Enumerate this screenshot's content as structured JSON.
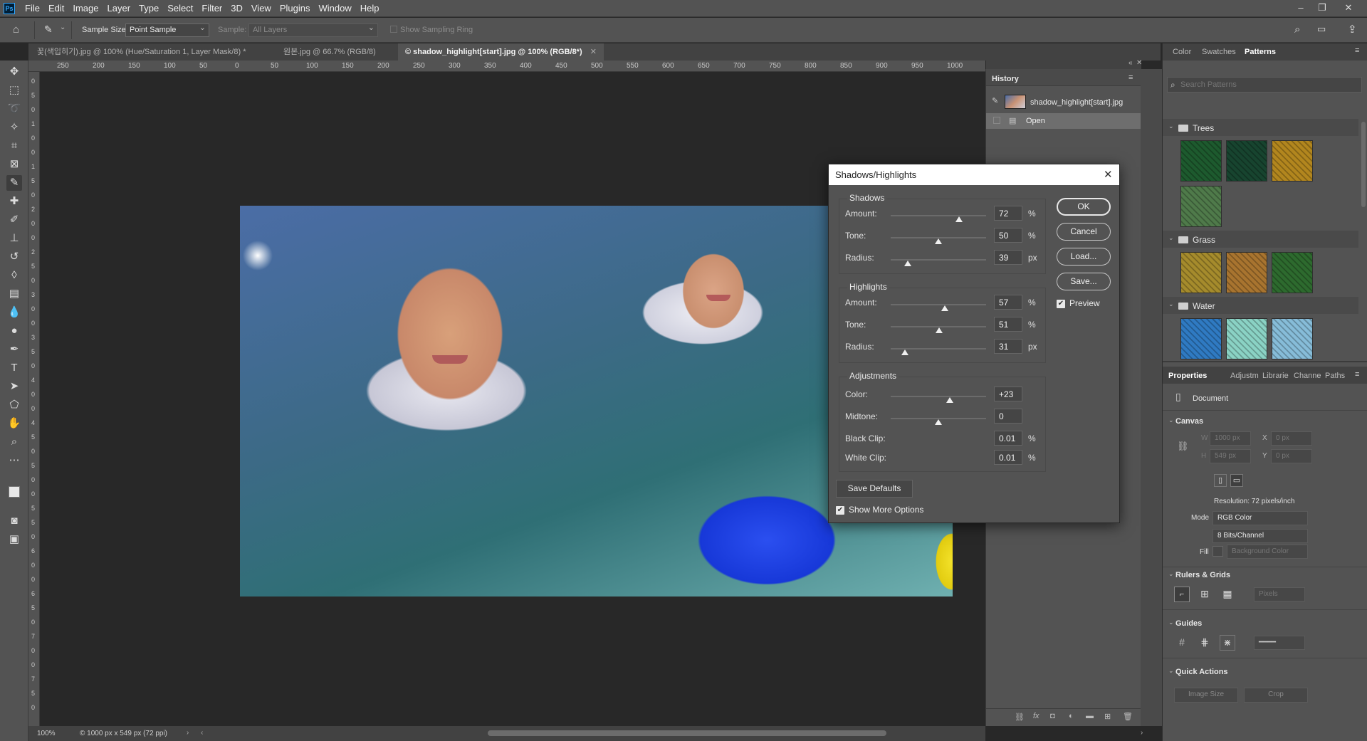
{
  "app": {
    "logo": "Ps",
    "menu": [
      "File",
      "Edit",
      "Image",
      "Layer",
      "Type",
      "Select",
      "Filter",
      "3D",
      "View",
      "Plugins",
      "Window",
      "Help"
    ],
    "window_controls": [
      "minimize-icon",
      "restore-icon",
      "close-icon"
    ]
  },
  "options": {
    "sample_size_label": "Sample Size:",
    "sample_size_value": "Point Sample",
    "sample_label": "Sample:",
    "sample_value": "All Layers",
    "sampling_ring_label": "Show Sampling Ring"
  },
  "tabs": [
    {
      "label": "꽃(색입히기).jpg @ 100% (Hue/Saturation 1, Layer Mask/8) *",
      "active": false
    },
    {
      "label": "원본.jpg @ 66.7% (RGB/8)",
      "active": false
    },
    {
      "label": "© shadow_highlight[start].jpg @ 100% (RGB/8*)",
      "active": true
    }
  ],
  "ruler_h": [
    "250",
    "200",
    "150",
    "100",
    "50",
    "0",
    "50",
    "100",
    "150",
    "200",
    "250",
    "300",
    "350",
    "400",
    "450",
    "500",
    "550",
    "600",
    "650",
    "700",
    "750",
    "800",
    "850",
    "900",
    "950",
    "1000"
  ],
  "ruler_v": [
    "0",
    "5",
    "0",
    "1",
    "0",
    "0",
    "1",
    "5",
    "0",
    "2",
    "0",
    "0",
    "2",
    "5",
    "0",
    "3",
    "0",
    "0",
    "3",
    "5",
    "0",
    "4",
    "0",
    "0",
    "4",
    "5",
    "0",
    "5",
    "0",
    "0",
    "5",
    "5",
    "0",
    "6",
    "0",
    "0",
    "6",
    "5",
    "0",
    "7",
    "0",
    "0",
    "7",
    "5",
    "0"
  ],
  "status": {
    "zoom": "100%",
    "doc_info": "© 1000 px x 549 px (72 ppi)"
  },
  "history": {
    "title": "History",
    "snapshot_label": "shadow_highlight[start].jpg",
    "items": [
      {
        "label": "Open"
      }
    ]
  },
  "patterns_panel": {
    "tabs": [
      "Color",
      "Swatches",
      "Patterns"
    ],
    "search_placeholder": "Search Patterns",
    "groups": [
      {
        "name": "Trees",
        "swatches": [
          "#1d5a2e",
          "#17442f",
          "#b2861e",
          "#4f7a4a"
        ]
      },
      {
        "name": "Grass",
        "swatches": [
          "#a58b2c",
          "#a8742f",
          "#2d6a2e"
        ]
      },
      {
        "name": "Water",
        "swatches": [
          "#2f7ac2",
          "#8ad2c4",
          "#86bcd8"
        ]
      }
    ]
  },
  "properties": {
    "tabs": [
      "Properties",
      "Adjustm",
      "Librarie",
      "Channe",
      "Paths"
    ],
    "doc_label": "Document",
    "canvas_label": "Canvas",
    "w_label": "W",
    "w_value": "1000 px",
    "h_label": "H",
    "h_value": "549 px",
    "x_label": "X",
    "x_value": "0 px",
    "y_label": "Y",
    "y_value": "0 px",
    "resolution": "Resolution: 72 pixels/inch",
    "mode_label": "Mode",
    "mode_value": "RGB Color",
    "bits_value": "8 Bits/Channel",
    "fill_label": "Fill",
    "fill_value": "Background Color",
    "rulers_label": "Rulers & Grids",
    "units_value": "Pixels",
    "guides_label": "Guides",
    "quick_label": "Quick Actions",
    "image_size_btn": "Image Size",
    "crop_btn": "Crop"
  },
  "dialog": {
    "title": "Shadows/Highlights",
    "shadows": {
      "label": "Shadows",
      "rows": [
        {
          "label": "Amount:",
          "value": "72",
          "unit": "%",
          "level": 0.72
        },
        {
          "label": "Tone:",
          "value": "50",
          "unit": "%",
          "level": 0.5
        },
        {
          "label": "Radius:",
          "value": "39",
          "unit": "px",
          "level": 0.18
        }
      ]
    },
    "highlights": {
      "label": "Highlights",
      "rows": [
        {
          "label": "Amount:",
          "value": "57",
          "unit": "%",
          "level": 0.57
        },
        {
          "label": "Tone:",
          "value": "51",
          "unit": "%",
          "level": 0.51
        },
        {
          "label": "Radius:",
          "value": "31",
          "unit": "px",
          "level": 0.15
        }
      ]
    },
    "adjustments": {
      "label": "Adjustments",
      "color_label": "Color:",
      "color_value": "+23",
      "color_level": 0.62,
      "midtone_label": "Midtone:",
      "midtone_value": "0",
      "midtone_level": 0.5,
      "black_label": "Black Clip:",
      "black_value": "0.01",
      "black_unit": "%",
      "white_label": "White Clip:",
      "white_value": "0.01",
      "white_unit": "%"
    },
    "buttons": {
      "ok": "OK",
      "cancel": "Cancel",
      "load": "Load...",
      "save": "Save..."
    },
    "preview_label": "Preview",
    "save_defaults": "Save Defaults",
    "more_options": "Show More Options"
  }
}
